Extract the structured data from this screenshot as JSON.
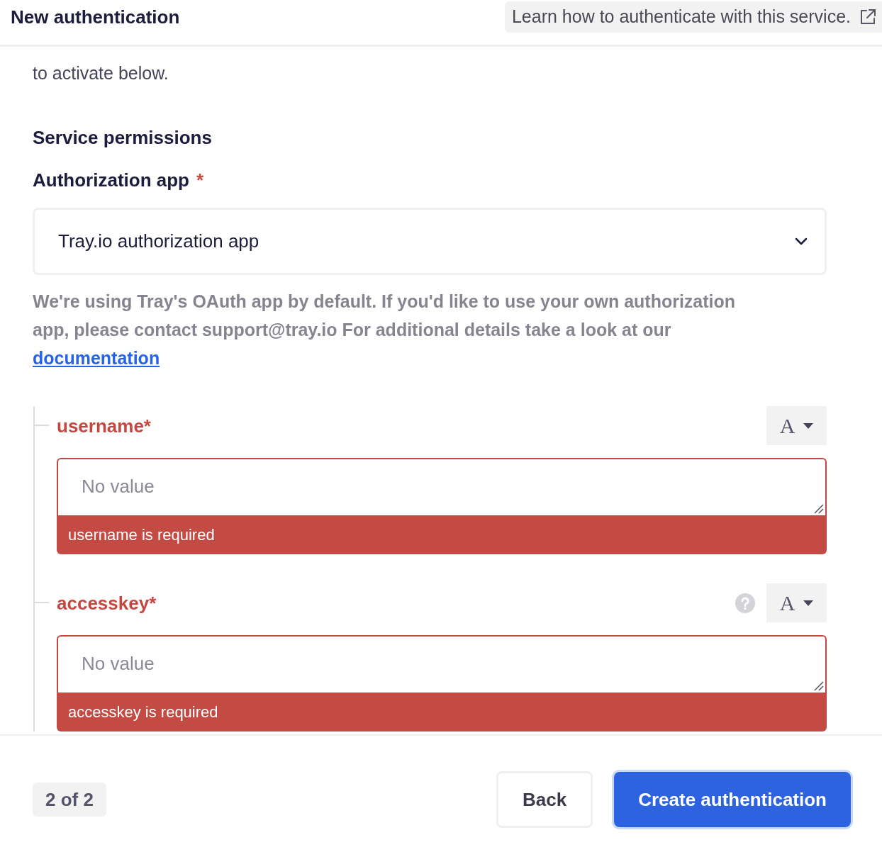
{
  "header": {
    "title": "New authentication",
    "help_link": "Learn how to authenticate with this service."
  },
  "intro_text": "to activate below.",
  "section_title": "Service permissions",
  "authorization_app": {
    "label": "Authorization app",
    "required_mark": "*",
    "value": "Tray.io authorization app",
    "help_text": "We're using Tray's OAuth app by default. If you'd like to use your own authorization app, please contact support@tray.io For additional details take a look at our",
    "help_link": "documentation"
  },
  "fields": [
    {
      "label": "username*",
      "help_icon": false,
      "type_button": "A",
      "placeholder": "No value",
      "error": "username is required"
    },
    {
      "label": "accesskey*",
      "help_icon": true,
      "type_button": "A",
      "placeholder": "No value",
      "error": "accesskey is required"
    }
  ],
  "footer": {
    "step": "2 of 2",
    "buttons": [
      {
        "label": "Back",
        "kind": "secondary"
      },
      {
        "label": "Create authentication",
        "kind": "primary"
      }
    ]
  }
}
